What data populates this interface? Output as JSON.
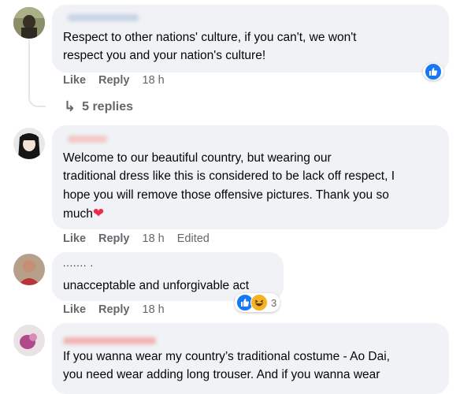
{
  "comments": [
    {
      "text_lines": [
        "Respect to other nations' culture, if you can't, we won't",
        "respect you and your nation's culture!"
      ],
      "actions": {
        "like": "Like",
        "reply": "Reply",
        "time": "18 h"
      },
      "reaction_icon": "like-icon"
    },
    {
      "text_lines": [
        "Welcome to our beautiful country, but wearing our",
        "traditional dress like this is considered to be lack off respect, I",
        "hope you will remove those offensive pictures. Thank you so",
        "much"
      ],
      "heart_emoji": "❤",
      "actions": {
        "like": "Like",
        "reply": "Reply",
        "time": "18 h",
        "edited": "Edited"
      }
    },
    {
      "name_partial": "....... .",
      "text_lines": [
        "unacceptable and unforgivable act"
      ],
      "actions": {
        "like": "Like",
        "reply": "Reply",
        "time": "18 h"
      },
      "reaction_count": "3",
      "reaction_icons": [
        "like-icon",
        "haha-icon"
      ]
    },
    {
      "text_lines": [
        "If you wanna wear my country’s traditional costume - Ao Dai,",
        "you need wear adding long trouser. And if you wanna wear"
      ]
    }
  ],
  "replies_link": {
    "arrow": "↳",
    "label": "5 replies"
  },
  "colors": {
    "bubble": "#f0f2f5",
    "meta": "#65676b",
    "like_blue": "#1877f2",
    "heart": "#f02849",
    "haha_yellow": "#f7b125"
  }
}
